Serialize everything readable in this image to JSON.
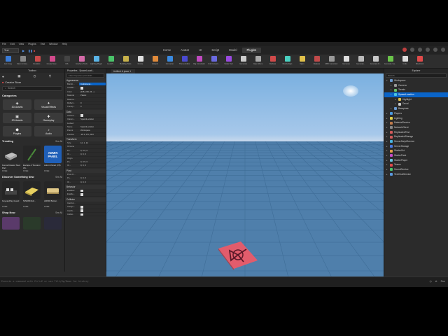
{
  "menu": [
    "File",
    "Edit",
    "View",
    "Plugins",
    "Test",
    "Window",
    "Help"
  ],
  "place_name": "Test",
  "ribbon_tabs": [
    "Home",
    "Avatar",
    "UI",
    "Script",
    "Model",
    "Plugins"
  ],
  "active_tab": "Plugins",
  "toolbar": [
    {
      "label": "Anti Copy",
      "color": "#3a7bd5"
    },
    {
      "label": "Moon Anima...",
      "color": "#888888"
    },
    {
      "label": "Realistic...",
      "color": "#c94a4a"
    },
    {
      "label": "Create New...",
      "color": "#d24a8c"
    },
    {
      "label": "MS",
      "color": "#444444"
    },
    {
      "label": "Interface Tools",
      "color": "#d46aa8"
    },
    {
      "label": "Lighting Plugin",
      "color": "#5ab4e6"
    },
    {
      "label": "Launch...",
      "color": "#4ac46a"
    },
    {
      "label": "Building Tools",
      "color": "#c7b14a"
    },
    {
      "label": "Rotate",
      "color": "#e0e0e0"
    },
    {
      "label": "Hotspot",
      "color": "#e08a3a"
    },
    {
      "label": "Converter",
      "color": "#3a8ae0"
    },
    {
      "label": "Theme Editor",
      "color": "#4a4ad0"
    },
    {
      "label": "Rig Constraint",
      "color": "#c04ac0"
    },
    {
      "label": "Unit Convert...",
      "color": "#6a6ae0"
    },
    {
      "label": "Scale Tool",
      "color": "#9a4ae0"
    },
    {
      "label": "Generate",
      "color": "#cccccc"
    },
    {
      "label": "Open Menu",
      "color": "#aaaaaa"
    },
    {
      "label": "Reclass",
      "color": "#d04a4a"
    },
    {
      "label": "ResizeAlign",
      "color": "#4ad0c0"
    },
    {
      "label": "Open",
      "color": "#e0c04a"
    },
    {
      "label": "Replace",
      "color": "#c04a4a"
    },
    {
      "label": "RBX Generator",
      "color": "#999999"
    },
    {
      "label": "Generate",
      "color": "#dddddd"
    },
    {
      "label": "Generate...",
      "color": "#bbbbbb"
    },
    {
      "label": "Generate R...",
      "color": "#c8c8c8"
    },
    {
      "label": "Generate Ga...",
      "color": "#6ac44a"
    },
    {
      "label": "Undo",
      "color": "#dddddd"
    },
    {
      "label": "Brushtool",
      "color": "#e04a4a"
    }
  ],
  "toolbox": {
    "title": "Toolbox",
    "store_label": "Creator Store",
    "search_placeholder": "Search",
    "categories_title": "Categories",
    "categories": [
      "3D Assets",
      "Visual Effects",
      "2D Assets",
      "Gameplay",
      "Plugins",
      "Audio"
    ],
    "trending_title": "Trending",
    "see_all": "See All",
    "trending": [
      {
        "name": "Fence/Classic Stud Part",
        "price": "FREE"
      },
      {
        "name": "Escape A Tsunami Wi...",
        "price": "FREE"
      },
      {
        "name": "Admin Panel (V5)",
        "price": "FREE"
      }
    ],
    "admin_panel_text": "ADMIN PANEL",
    "discover_title": "Discover Something New",
    "discover": [
      {
        "name": "KeycapPlay board",
        "price": "FREE"
      },
      {
        "name": "NINDBNGZ...",
        "price": "FREE"
      },
      {
        "name": "ARMR Button",
        "price": "FREE"
      }
    ],
    "shop_title": "Shop Now"
  },
  "properties": {
    "title": "Properties - SpawnLocati...",
    "filter": "Filter Properties (Ctrl+Shift...",
    "sections": [
      {
        "name": "Appearance",
        "rows": [
          {
            "k": "BrickC...",
            "v": "Institutional...",
            "sel": true
          },
          {
            "k": "CastSh...",
            "v": "chk"
          },
          {
            "k": "Color",
            "v": "[248, 248, 24...]"
          },
          {
            "k": "Material",
            "v": "Plastic"
          },
          {
            "k": "Materia...",
            "v": ""
          },
          {
            "k": "Reflect...",
            "v": "0"
          },
          {
            "k": "Transp...",
            "v": "0"
          }
        ]
      },
      {
        "name": "Data",
        "rows": [
          {
            "k": "Archiva...",
            "v": "chk"
          },
          {
            "k": "Classn...",
            "v": "SpawnLocation"
          },
          {
            "k": "Locked",
            "v": ""
          },
          {
            "k": "Name",
            "v": "SpawnLocation"
          },
          {
            "k": "Parent",
            "v": "Workspace"
          },
          {
            "k": "Position",
            "v": "-26.0, 0.5, 29.0"
          }
        ]
      },
      {
        "name": "Transform",
        "rows": [
          {
            "k": "Size",
            "v": "12, 1, 12"
          },
          {
            "k": "CFrame",
            "v": ""
          },
          {
            "k": "Po...",
            "v": "0, 0.5, 0"
          },
          {
            "k": "Or...",
            "v": "0, 0, 0"
          },
          {
            "k": "Origin",
            "v": ""
          },
          {
            "k": "Po...",
            "v": "0, 0.5, 0"
          },
          {
            "k": "Or...",
            "v": "0, 0, 0"
          }
        ]
      },
      {
        "name": "Pivot",
        "rows": [
          {
            "k": "Pivot O...",
            "v": ""
          },
          {
            "k": "Po...",
            "v": "0, 0, 0"
          },
          {
            "k": "Or...",
            "v": "0, 0, 0"
          }
        ]
      },
      {
        "name": "Behavior",
        "rows": [
          {
            "k": "Enabled",
            "v": "chk"
          },
          {
            "k": "Enable...",
            "v": "chk"
          }
        ]
      },
      {
        "name": "Collision",
        "rows": [
          {
            "k": "CanCol...",
            "v": ""
          },
          {
            "k": "CanQu...",
            "v": "chk"
          },
          {
            "k": "CanTo...",
            "v": "chk"
          },
          {
            "k": "Collisi...",
            "v": "chk"
          }
        ]
      }
    ]
  },
  "viewport": {
    "tab_label": "Untitled & place 1"
  },
  "explorer": {
    "title": "Explorer",
    "search_placeholder": "Search",
    "items": [
      {
        "label": "Workspace",
        "depth": 0,
        "color": "#6a9ad0",
        "open": true
      },
      {
        "label": "Camera",
        "depth": 1,
        "color": "#9a9a9a"
      },
      {
        "label": "Terrain",
        "depth": 1,
        "color": "#6ac46a"
      },
      {
        "label": "SpawnLocation",
        "depth": 1,
        "color": "#4ac4e0",
        "sel": true
      },
      {
        "label": "Highlight",
        "depth": 2,
        "color": "#e0c04a"
      },
      {
        "label": "Decal",
        "depth": 2,
        "color": "#c8c8c8"
      },
      {
        "label": "Baseplate",
        "depth": 1,
        "color": "#6a9ad0"
      },
      {
        "label": "Players",
        "depth": 0,
        "color": "#4a9ae0"
      },
      {
        "label": "Lighting",
        "depth": 0,
        "color": "#e0d04a"
      },
      {
        "label": "MaterialService",
        "depth": 0,
        "color": "#c07a4a"
      },
      {
        "label": "NetworkClient",
        "depth": 0,
        "color": "#888888"
      },
      {
        "label": "ReplicatedFirst",
        "depth": 0,
        "color": "#d05a5a"
      },
      {
        "label": "ReplicatedStorage",
        "depth": 0,
        "color": "#d05a5a"
      },
      {
        "label": "ServerScriptService",
        "depth": 0,
        "color": "#4ab4e0"
      },
      {
        "label": "ServerStorage",
        "depth": 0,
        "color": "#4a7ae0"
      },
      {
        "label": "StarterGui",
        "depth": 0,
        "color": "#e0a04a"
      },
      {
        "label": "StarterPack",
        "depth": 0,
        "color": "#c84ac8"
      },
      {
        "label": "StarterPlayer",
        "depth": 0,
        "color": "#6ac4e0"
      },
      {
        "label": "Teams",
        "depth": 0,
        "color": "#e04a4a"
      },
      {
        "label": "SoundService",
        "depth": 0,
        "color": "#4ac46a"
      },
      {
        "label": "TextChatService",
        "depth": 0,
        "color": "#5a9ae0"
      }
    ]
  },
  "command_bar": {
    "placeholder": "Execute a command with Ctrl+E or use Tilt/Up/Down for history",
    "run_label": "Run"
  }
}
